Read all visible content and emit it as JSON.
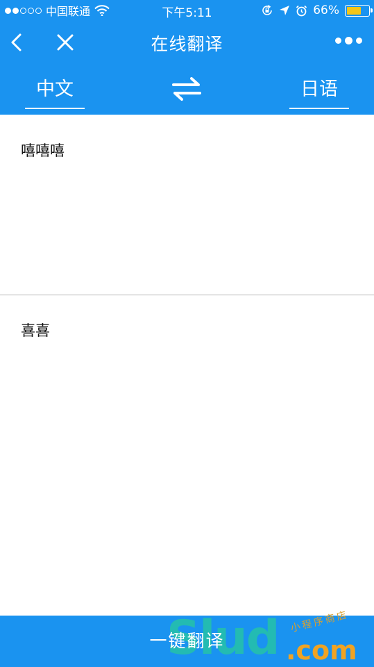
{
  "status_bar": {
    "carrier": "中国联通",
    "time": "下午5:11",
    "battery_pct": "66%",
    "battery_level": 0.66,
    "signal_bars_filled": 2,
    "signal_bars_total": 5
  },
  "nav": {
    "title": "在线翻译",
    "back_icon": "chevron-left-icon",
    "close_icon": "close-icon",
    "more_icon": "more-dots-icon"
  },
  "languages": {
    "source": "中文",
    "target": "日语",
    "swap_icon": "swap-arrows-icon"
  },
  "input": {
    "text": "嘻嘻嘻"
  },
  "output": {
    "text": "喜喜"
  },
  "actions": {
    "translate_label": "一键翻译"
  },
  "watermark": {
    "brand": "Slud",
    "domain": ".com",
    "tagline": "小程序商店"
  },
  "colors": {
    "primary": "#1a93f0",
    "divider": "#b5b5b5",
    "text": "#111111",
    "battery": "#f5c518"
  }
}
